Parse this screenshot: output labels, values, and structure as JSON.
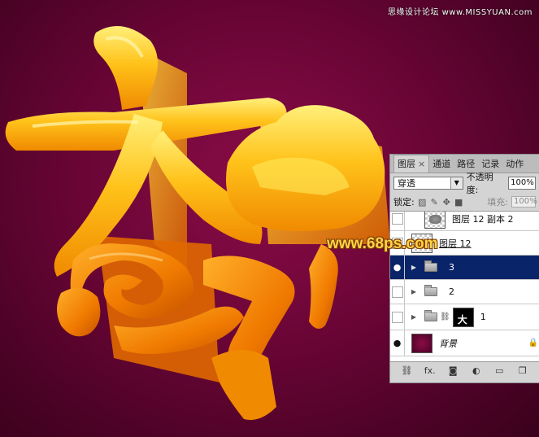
{
  "watermarks": {
    "top_right": "思缘设计论坛 www.MISSYUAN.com",
    "center": "www.68ps.com"
  },
  "colors": {
    "background": "#6a0536",
    "gold_light": "#ffe14a",
    "gold_dark": "#f07a00",
    "selection": "#0a246a"
  },
  "layers_panel": {
    "tabs": [
      {
        "label": "图层",
        "close": "×"
      },
      {
        "label": "通道"
      },
      {
        "label": "路径"
      },
      {
        "label": "记录"
      },
      {
        "label": "动作"
      }
    ],
    "blend_mode": "穿透",
    "opacity_label": "不透明度:",
    "opacity_value": "100%",
    "lock_label": "锁定:",
    "fill_label": "填充:",
    "fill_value": "100%",
    "layers": [
      {
        "name": "图层 12 副本 2",
        "thumb": "checker-gray",
        "visible": false
      },
      {
        "name": "图层 12",
        "thumb": "checker-orange",
        "visible": false
      },
      {
        "name": "3",
        "type": "group",
        "visible": true,
        "selected": true
      },
      {
        "name": "2",
        "type": "group",
        "visible": false
      },
      {
        "name": "1",
        "type": "group-mask",
        "visible": false
      },
      {
        "name": "背景",
        "thumb": "background",
        "visible": true,
        "locked": true
      }
    ],
    "bottom_icons": [
      "link-icon",
      "fx-icon",
      "mask-icon",
      "adjustment-icon",
      "new-group-icon",
      "new-layer-icon"
    ],
    "fx_label": "fx."
  }
}
